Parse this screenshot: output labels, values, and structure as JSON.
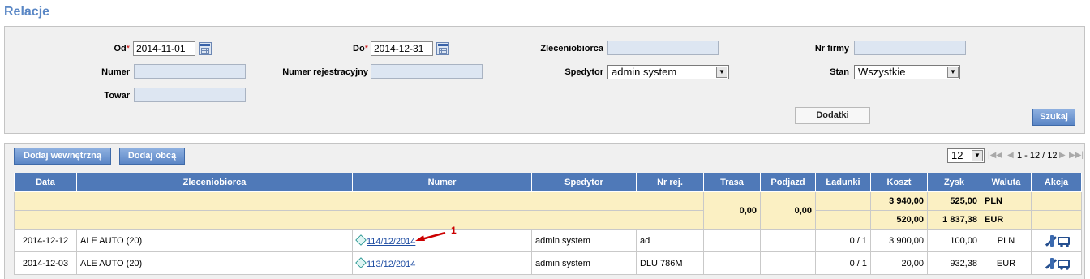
{
  "page": {
    "title": "Relacje"
  },
  "filters": {
    "od": {
      "label": "Od",
      "required_mark": "*",
      "value": "2014-11-01"
    },
    "do": {
      "label": "Do",
      "required_mark": "*",
      "value": "2014-12-31"
    },
    "zleceniobiorca": {
      "label": "Zleceniobiorca",
      "value": ""
    },
    "nr_firmy": {
      "label": "Nr firmy",
      "value": ""
    },
    "numer": {
      "label": "Numer",
      "value": ""
    },
    "numer_rejestracyjny": {
      "label": "Numer rejestracyjny",
      "value": ""
    },
    "spedytor": {
      "label": "Spedytor",
      "value": "admin system"
    },
    "stan": {
      "label": "Stan",
      "value": "Wszystkie"
    },
    "towar": {
      "label": "Towar",
      "value": ""
    },
    "dodatki_button": "Dodatki",
    "szukaj_button": "Szukaj"
  },
  "results": {
    "add_internal_button": "Dodaj wewnętrzną",
    "add_external_button": "Dodaj obcą",
    "page_size": "12",
    "page_info": "1 - 12 / 12",
    "columns": [
      "Data",
      "Zleceniobiorca",
      "Numer",
      "Spedytor",
      "Nr rej.",
      "Trasa",
      "Podjazd",
      "Ładunki",
      "Koszt",
      "Zysk",
      "Waluta",
      "Akcja"
    ],
    "summary": {
      "trasa": "0,00",
      "podjazd": "0,00",
      "rows": [
        {
          "koszt": "3 940,00",
          "zysk": "525,00",
          "waluta": "PLN"
        },
        {
          "koszt": "520,00",
          "zysk": "1 837,38",
          "waluta": "EUR"
        }
      ]
    },
    "rows": [
      {
        "data": "2014-12-12",
        "zleceniobiorca": "ALE AUTO (20)",
        "numer": "114/12/2014",
        "spedytor": "admin system",
        "nr_rej": "ad",
        "trasa": "",
        "podjazd": "",
        "ladunki": "0 / 1",
        "koszt": "3 900,00",
        "zysk": "100,00",
        "waluta": "PLN"
      },
      {
        "data": "2014-12-03",
        "zleceniobiorca": "ALE AUTO (20)",
        "numer": "113/12/2014",
        "spedytor": "admin system",
        "nr_rej": "DLU 786M",
        "trasa": "",
        "podjazd": "",
        "ladunki": "0 / 1",
        "koszt": "20,00",
        "zysk": "932,38",
        "waluta": "EUR"
      }
    ]
  },
  "annotation": {
    "label": "1",
    "color": "#cc0000"
  },
  "icons": {
    "calendar": "calendar-icon",
    "dropdown": "chevron-down-icon",
    "numer": "document-icon",
    "actions": [
      "edit-icon",
      "truck-icon"
    ],
    "pager": [
      "first-page-icon",
      "prev-page-icon",
      "next-page-icon",
      "last-page-icon"
    ]
  }
}
